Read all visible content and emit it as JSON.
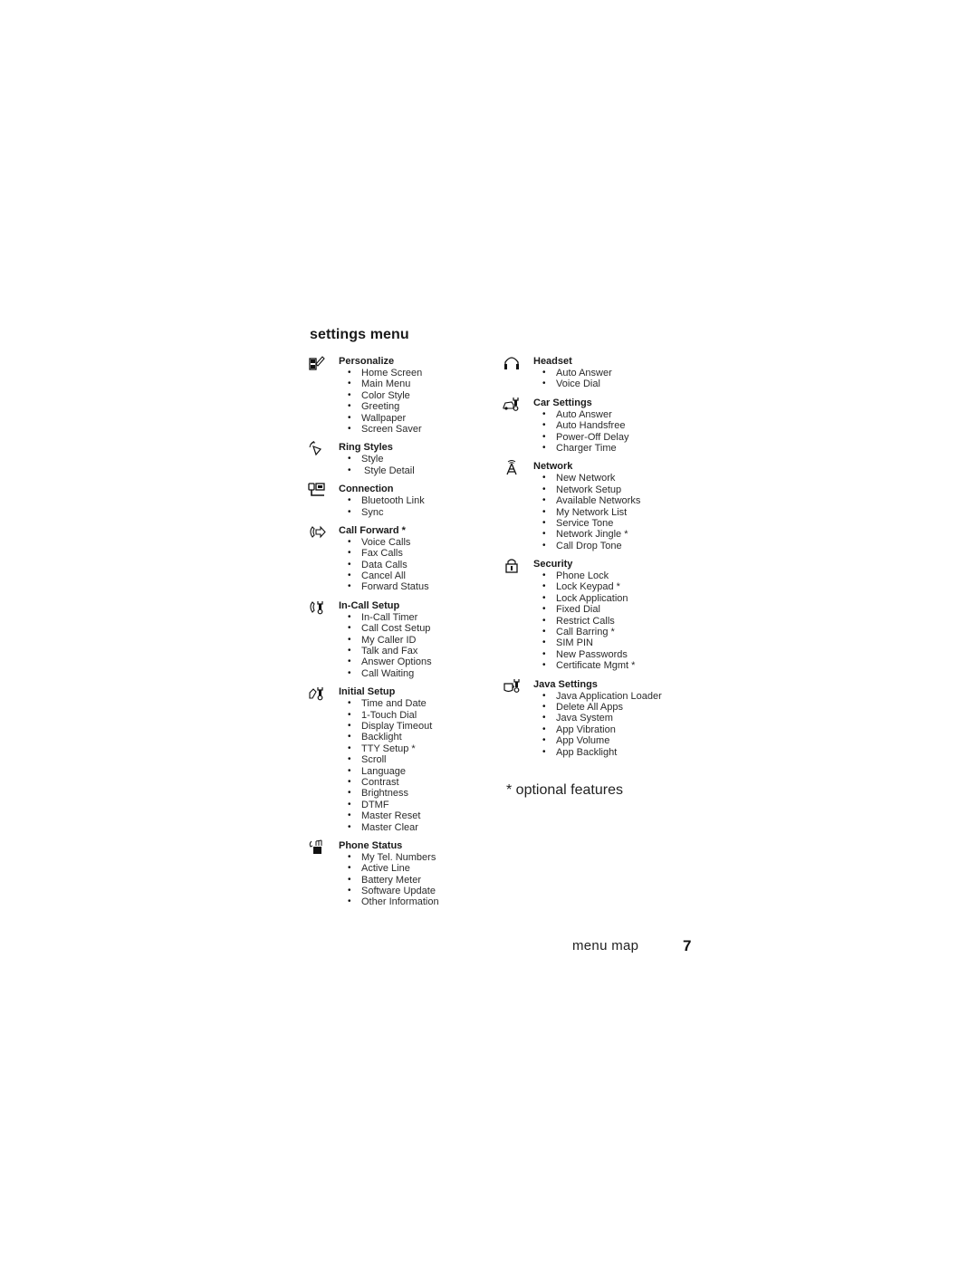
{
  "page": {
    "title": "settings menu",
    "footnote": "* optional features",
    "footer_label": "menu map",
    "page_number": "7"
  },
  "left_column": [
    {
      "icon": "personalize-icon",
      "heading": "Personalize",
      "items": [
        "Home Screen",
        "Main Menu",
        "Color Style",
        "Greeting",
        "Wallpaper",
        "Screen Saver"
      ]
    },
    {
      "icon": "ring-styles-icon",
      "heading": "Ring Styles",
      "items": [
        "Style",
        " Style Detail"
      ]
    },
    {
      "icon": "connection-icon",
      "heading": "Connection",
      "items": [
        "Bluetooth Link",
        "Sync"
      ]
    },
    {
      "icon": "call-forward-icon",
      "heading": "Call Forward *",
      "items": [
        "Voice Calls",
        "Fax Calls",
        "Data Calls",
        "Cancel All",
        "Forward Status"
      ]
    },
    {
      "icon": "in-call-setup-icon",
      "heading": "In-Call Setup",
      "items": [
        "In-Call Timer",
        "Call Cost Setup",
        "My Caller ID",
        "Talk and Fax",
        "Answer Options",
        "Call Waiting"
      ]
    },
    {
      "icon": "initial-setup-icon",
      "heading": "Initial Setup",
      "items": [
        "Time and Date",
        "1-Touch Dial",
        "Display Timeout",
        "Backlight",
        "TTY Setup *",
        "Scroll",
        "Language",
        "Contrast",
        "Brightness",
        "DTMF",
        "Master Reset",
        "Master Clear"
      ]
    },
    {
      "icon": "phone-status-icon",
      "heading": "Phone Status",
      "items": [
        "My Tel. Numbers",
        "Active Line",
        "Battery Meter",
        "Software Update",
        "Other Information"
      ]
    }
  ],
  "right_column": [
    {
      "icon": "headset-icon",
      "heading": "Headset",
      "items": [
        "Auto Answer",
        "Voice Dial"
      ]
    },
    {
      "icon": "car-settings-icon",
      "heading": "Car Settings",
      "items": [
        "Auto Answer",
        "Auto Handsfree",
        "Power-Off Delay",
        "Charger Time"
      ]
    },
    {
      "icon": "network-icon",
      "heading": "Network",
      "items": [
        "New Network",
        "Network Setup",
        "Available Networks",
        "My Network List",
        "Service Tone",
        "Network Jingle *",
        "Call Drop Tone"
      ]
    },
    {
      "icon": "security-icon",
      "heading": "Security",
      "items": [
        "Phone Lock",
        "Lock Keypad *",
        "Lock Application",
        "Fixed Dial",
        "Restrict Calls",
        "Call Barring *",
        "SIM PIN",
        "New Passwords",
        "Certificate Mgmt *"
      ]
    },
    {
      "icon": "java-settings-icon",
      "heading": "Java Settings",
      "items": [
        "Java Application Loader",
        "Delete All Apps",
        "Java System",
        "App Vibration",
        "App Volume",
        "App Backlight"
      ]
    }
  ],
  "bullet": "•"
}
